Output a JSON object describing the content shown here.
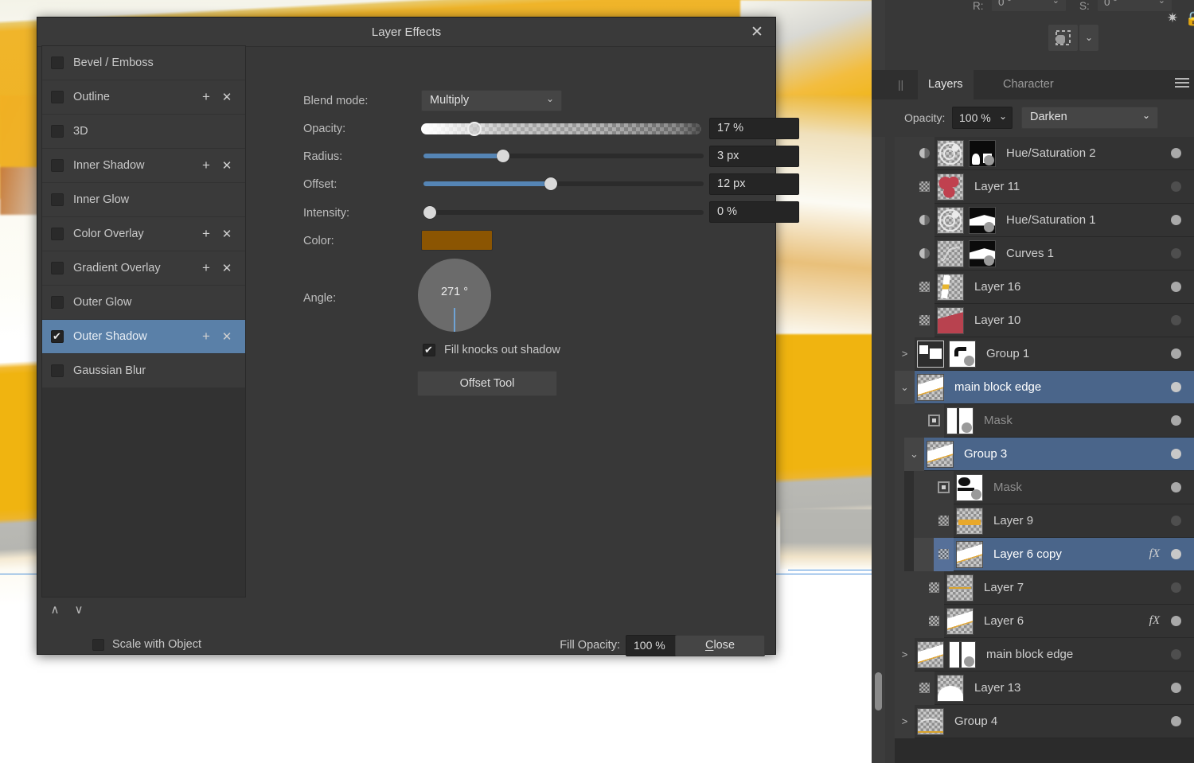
{
  "dialog": {
    "title": "Layer Effects",
    "close_icon": "close-icon",
    "effects": [
      {
        "label": "Bevel / Emboss",
        "checked": false,
        "selected": false,
        "has_actions": false
      },
      {
        "label": "Outline",
        "checked": false,
        "selected": false,
        "has_actions": true
      },
      {
        "label": "3D",
        "checked": false,
        "selected": false,
        "has_actions": false
      },
      {
        "label": "Inner Shadow",
        "checked": false,
        "selected": false,
        "has_actions": true
      },
      {
        "label": "Inner Glow",
        "checked": false,
        "selected": false,
        "has_actions": false
      },
      {
        "label": "Color Overlay",
        "checked": false,
        "selected": false,
        "has_actions": true
      },
      {
        "label": "Gradient Overlay",
        "checked": false,
        "selected": false,
        "has_actions": true
      },
      {
        "label": "Outer Glow",
        "checked": false,
        "selected": false,
        "has_actions": false
      },
      {
        "label": "Outer Shadow",
        "checked": true,
        "selected": true,
        "has_actions": true
      },
      {
        "label": "Gaussian Blur",
        "checked": false,
        "selected": false,
        "has_actions": false
      }
    ],
    "plus_label": "+",
    "remove_label": "✕",
    "move_up_label": "∧",
    "move_down_label": "∨",
    "scale_with_object": "Scale with Object",
    "fill_opacity_label": "Fill Opacity:",
    "fill_opacity_value": "100 %",
    "close_button": "Close",
    "properties": {
      "blend_mode_label": "Blend mode:",
      "blend_mode_value": "Multiply",
      "opacity_label": "Opacity:",
      "opacity_value": "17 %",
      "radius_label": "Radius:",
      "radius_value": "3 px",
      "offset_label": "Offset:",
      "offset_value": "12 px",
      "intensity_label": "Intensity:",
      "intensity_value": "0 %",
      "color_label": "Color:",
      "color_value": "#8b5502",
      "angle_label": "Angle:",
      "angle_value": "271 °",
      "fill_knocks_out_shadow": "Fill knocks out shadow",
      "offset_tool_button": "Offset Tool"
    }
  },
  "right_dock": {
    "transform": {
      "rotation_label": "R:",
      "rotation_value": "0 °",
      "shear_label": "S:",
      "shear_value": "0 °"
    },
    "tabs": [
      {
        "label": "Layers",
        "active": true
      },
      {
        "label": "Character",
        "active": false
      }
    ],
    "menu_icon": "hamburger-menu-icon",
    "opacity_label": "Opacity:",
    "opacity_value": "100 %",
    "blend_mode_value": "Darken",
    "gear_icon": "gear-icon",
    "lock_icon": "lock-icon",
    "layers": [
      {
        "name": "Hue/Saturation 2",
        "indent": 0,
        "vis": "half",
        "thumb": "hue",
        "mask": "maskblock",
        "dot": "on",
        "fx": false,
        "selected": false,
        "toggle": ""
      },
      {
        "name": "Layer 11",
        "indent": 0,
        "vis": "checker",
        "thumb": "red",
        "mask": null,
        "dot": "off",
        "fx": false,
        "selected": false,
        "toggle": ""
      },
      {
        "name": "Hue/Saturation 1",
        "indent": 0,
        "vis": "half",
        "thumb": "hue",
        "mask": "maskshape",
        "dot": "on",
        "fx": false,
        "selected": false,
        "toggle": ""
      },
      {
        "name": "Curves 1",
        "indent": 0,
        "vis": "half",
        "thumb": "curves",
        "mask": "maskshape",
        "dot": "off",
        "fx": false,
        "selected": false,
        "toggle": ""
      },
      {
        "name": "Layer 16",
        "indent": 0,
        "vis": "checker",
        "thumb": "yellow",
        "mask": null,
        "dot": "on",
        "fx": false,
        "selected": false,
        "toggle": ""
      },
      {
        "name": "Layer 10",
        "indent": 0,
        "vis": "checker",
        "thumb": "redblock",
        "mask": null,
        "dot": "off",
        "fx": false,
        "selected": false,
        "toggle": ""
      },
      {
        "name": "Group 1",
        "indent": 0,
        "vis": null,
        "thumb": "grp1",
        "mask": "arrow",
        "dot": "on",
        "fx": false,
        "selected": false,
        "toggle": ">"
      },
      {
        "name": "main block edge",
        "indent": 0,
        "vis": null,
        "thumb": "diag",
        "mask": null,
        "dot": "on",
        "fx": false,
        "selected": true,
        "toggle": "⌄"
      },
      {
        "name": "Mask",
        "indent": 1,
        "vis": "mask",
        "thumb": "masklr",
        "mask": null,
        "dot": "on",
        "fx": false,
        "selected": false,
        "toggle": "",
        "dim": true
      },
      {
        "name": "Group 3",
        "indent": 1,
        "vis": null,
        "thumb": "diag",
        "mask": null,
        "dot": "on",
        "fx": false,
        "selected": true,
        "toggle": "⌄"
      },
      {
        "name": "Mask",
        "indent": 2,
        "vis": "mask",
        "thumb": "blobmask",
        "mask": null,
        "dot": "on",
        "fx": false,
        "selected": false,
        "toggle": "",
        "dim": true
      },
      {
        "name": "Layer 9",
        "indent": 2,
        "vis": "checker",
        "thumb": "bar",
        "mask": null,
        "dot": "off",
        "fx": false,
        "selected": false,
        "toggle": ""
      },
      {
        "name": "Layer 6 copy",
        "indent": 2,
        "vis": "checker",
        "thumb": "diag",
        "mask": null,
        "dot": "on",
        "fx": true,
        "selected": true,
        "toggle": ""
      },
      {
        "name": "Layer 7",
        "indent": 1,
        "vis": "checker",
        "thumb": "bar2",
        "mask": null,
        "dot": "off",
        "fx": false,
        "selected": false,
        "toggle": ""
      },
      {
        "name": "Layer 6",
        "indent": 1,
        "vis": "checker",
        "thumb": "diag",
        "mask": null,
        "dot": "on",
        "fx": true,
        "selected": false,
        "toggle": ""
      },
      {
        "name": "main block edge",
        "indent": 0,
        "vis": null,
        "thumb": "diag",
        "mask": "masklr",
        "dot": "off",
        "fx": false,
        "selected": false,
        "toggle": ">"
      },
      {
        "name": "Layer 13",
        "indent": 0,
        "vis": "checker",
        "thumb": "hill",
        "mask": null,
        "dot": "on",
        "fx": false,
        "selected": false,
        "toggle": ""
      },
      {
        "name": "Group 4",
        "indent": 0,
        "vis": null,
        "thumb": "hill2",
        "mask": null,
        "dot": "on",
        "fx": false,
        "selected": false,
        "toggle": ">"
      }
    ],
    "fx_badge": "fX",
    "scrollbar": "vertical-scrollbar"
  }
}
